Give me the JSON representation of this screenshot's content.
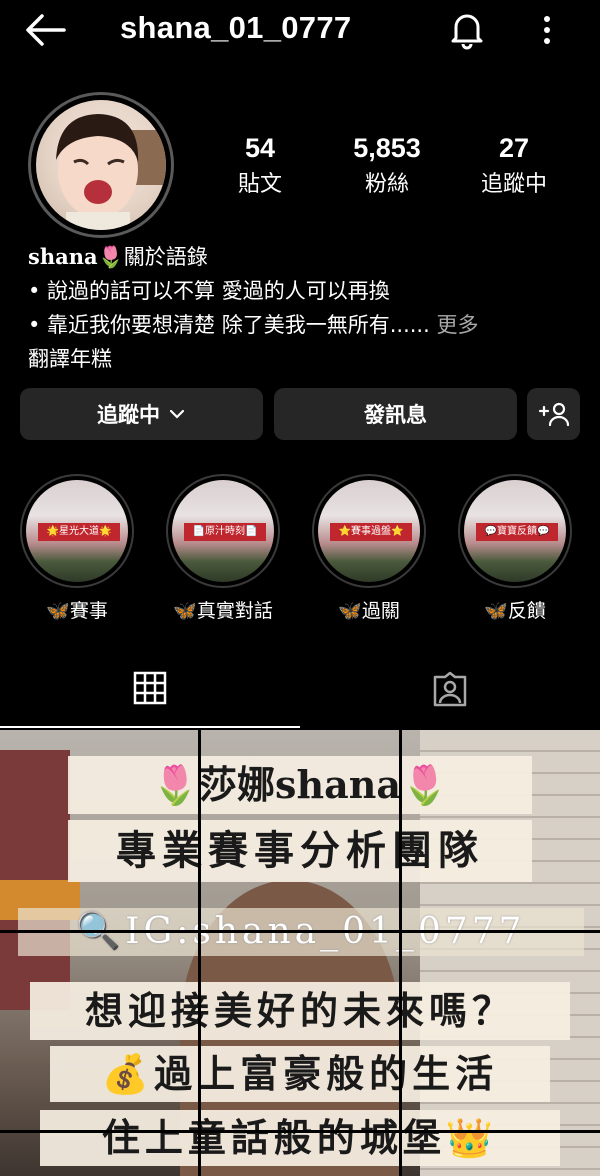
{
  "header": {
    "username": "shana_01_0777",
    "icons": [
      "back-arrow-icon",
      "bell-icon",
      "more-vertical-icon"
    ]
  },
  "stats": [
    {
      "value": "54",
      "label": "貼文"
    },
    {
      "value": "5,853",
      "label": "粉絲"
    },
    {
      "value": "27",
      "label": "追蹤中"
    }
  ],
  "bio": {
    "name": "shana",
    "name_emoji": "🌷",
    "name_suffix": "關於語錄",
    "line1": "• 說過的話可以不算 愛過的人可以再換",
    "line2": "• 靠近我你要想清楚 除了美我一無所有......",
    "more": "更多",
    "translate": "翻譯年糕"
  },
  "actions": {
    "follow_label": "追蹤中",
    "message_label": "發訊息"
  },
  "highlights": [
    {
      "banner": "🌟星光大道🌟",
      "label": "🦋賽事"
    },
    {
      "banner": "📄原汁時刻📄",
      "label": "🦋真實對話"
    },
    {
      "banner": "⭐賽事過盤⭐",
      "label": "🦋過關"
    },
    {
      "banner": "💬寶寶反饋💬",
      "label": "🦋反饋"
    }
  ],
  "post": {
    "line1": "🌷莎娜shana🌷",
    "line2": "專業賽事分析團隊",
    "line3": "🔍IG:shana_01_0777",
    "line4": "想迎接美好的未來嗎？",
    "line5": "💰過上富豪般的生活",
    "line6": "住上童話般的城堡👑"
  },
  "colors": {
    "background": "#000000",
    "button": "#262626",
    "muted_text": "#a8a8a8",
    "highlight_banner": "#c0262d"
  }
}
